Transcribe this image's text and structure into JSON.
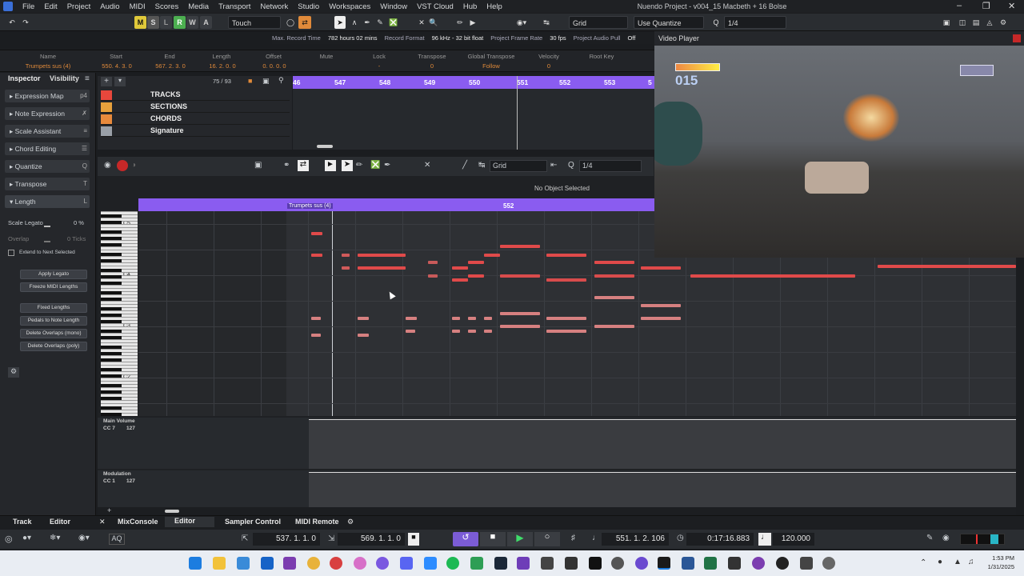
{
  "menubar": {
    "items": [
      "File",
      "Edit",
      "Project",
      "Audio",
      "MIDI",
      "Scores",
      "Media",
      "Transport",
      "Network",
      "Studio",
      "Workspaces",
      "Window",
      "VST Cloud",
      "Hub",
      "Help"
    ],
    "title": "Nuendo Project - v004_15 Macbeth + 16 Bolse"
  },
  "toolbar": {
    "m": "M",
    "s": "S",
    "l": "L",
    "r": "R",
    "w": "W",
    "a": "A",
    "automation_mode": "Touch",
    "snap_type": "Grid",
    "quantize_mode": "Use Quantize",
    "quantize_value": "1/4"
  },
  "infobar": {
    "max_record_label": "Max. Record Time",
    "max_record": "782 hours 02 mins",
    "record_format_label": "Record Format",
    "record_format": "96 kHz - 32 bit float",
    "frame_rate_label": "Project Frame Rate",
    "frame_rate": "30 fps",
    "pull_label": "Project Audio Pull",
    "pull": "Off"
  },
  "infoline": {
    "headers": [
      "Name",
      "Start",
      "End",
      "Length",
      "Offset",
      "Mute",
      "Lock",
      "Transpose",
      "Global Transpose",
      "Velocity",
      "Root Key"
    ],
    "values": [
      "Trumpets sus (4)",
      "550. 4. 3.   0",
      "567. 2. 3.   0",
      "16. 2. 0.   0",
      "0. 0. 0.   0",
      "",
      "-",
      "0",
      "Follow",
      "0",
      ""
    ]
  },
  "inspector": {
    "tab_inspector": "Inspector",
    "tab_visibility": "Visibility",
    "sections": [
      "Expression Map",
      "Note Expression",
      "Scale Assistant",
      "Chord Editing",
      "Quantize",
      "Transpose",
      "Length"
    ],
    "scale_legato": "Scale Legato",
    "scale_legato_val": "0 %",
    "overlap": "Overlap",
    "overlap_val": "0 Ticks",
    "extend": "Extend to Next Selected",
    "buttons": [
      "Apply Legato",
      "Freeze MIDI Lengths",
      "Fixed Lengths",
      "Pedals to Note Length",
      "Delete Overlaps (mono)",
      "Delete Overlaps (poly)"
    ]
  },
  "tracklist": {
    "counter": "75 / 93",
    "tracks": [
      "TRACKS",
      "SECTIONS",
      "CHORDS",
      "Signature"
    ],
    "colors": [
      "#e8473c",
      "#e8a13c",
      "#e88a3c",
      "#9aa0a8"
    ]
  },
  "arrange": {
    "ruler": [
      "46",
      "547",
      "548",
      "549",
      "550",
      "551",
      "552",
      "553",
      "5"
    ]
  },
  "editor": {
    "snap": "Grid",
    "quant": "1/4",
    "status": "No Object Selected",
    "part_name": "Trumpets sus (4)",
    "ruler_mark": "552",
    "key_labels": [
      "C5",
      "C4",
      "C3",
      "C2"
    ],
    "cc1_name": "Main Volume",
    "cc1_sub": "CC 7",
    "cc1_val": "127",
    "cc2_name": "Modulation",
    "cc2_sub": "CC 1",
    "cc2_val": "127"
  },
  "video": {
    "title": "Video Player",
    "hud_score": "015"
  },
  "bottomtabs": {
    "track": "Track",
    "editor": "Editor",
    "mixconsole": "MixConsole",
    "editor2": "Editor",
    "sampler": "Sampler Control",
    "midiremote": "MIDI Remote"
  },
  "transport": {
    "left_locator": "537. 1. 1.   0",
    "right_locator": "569. 1. 1.   0",
    "position": "551. 1. 2. 106",
    "time": "0:17:16.883",
    "tempo": "120.000",
    "aq": "AQ"
  },
  "taskbar": {
    "time": "1:53 PM",
    "date": "1/31/2025"
  }
}
